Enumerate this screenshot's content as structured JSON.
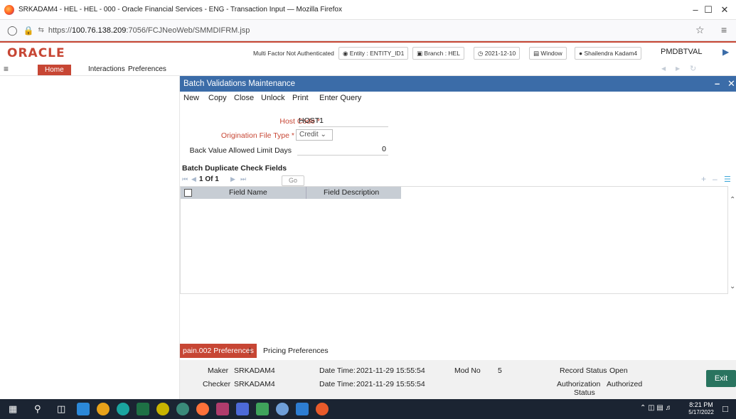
{
  "browser": {
    "window_title": "SRKADAM4 - HEL - HEL - 000 - Oracle Financial Services - ENG - Transaction Input — Mozilla Firefox",
    "url_prefix": "https://",
    "url_host": "100.76.138.209",
    "url_rest": ":7056/FCJNeoWeb/SMMDIFRM.jsp"
  },
  "header": {
    "logo": "ORACLE",
    "mfa": "Multi Factor Not Authenticated",
    "entity": "Entity : ENTITY_ID1",
    "branch": "Branch : HEL",
    "date": "2021-12-10",
    "window": "Window",
    "user": "Shailendra Kadam4",
    "function_id": "PMDBTVAL"
  },
  "menu": {
    "home": "Home",
    "interactions": "Interactions",
    "preferences": "Preferences"
  },
  "form": {
    "title": "Batch Validations Maintenance",
    "toolbar": {
      "new": "New",
      "copy": "Copy",
      "close": "Close",
      "unlock": "Unlock",
      "print": "Print",
      "enter_query": "Enter Query"
    },
    "host_code_label": "Host Code",
    "host_code_value": "HOST1",
    "orig_type_label": "Origination File Type",
    "orig_type_value": "Credit",
    "back_value_label": "Back Value Allowed Limit Days",
    "back_value_value": "0",
    "section_title": "Batch Duplicate Check Fields",
    "pager": "1 Of 1",
    "go": "Go",
    "columns": [
      "Field Name",
      "Field Description"
    ]
  },
  "tabs": {
    "active": "pain.002 Preferences",
    "separator": "|",
    "other": "Pricing Preferences"
  },
  "footer": {
    "maker_label": "Maker",
    "maker": "SRKADAM4",
    "checker_label": "Checker",
    "checker": "SRKADAM4",
    "datetime_label": "Date Time:",
    "maker_datetime": "2021-11-29 15:55:54",
    "checker_datetime": "2021-11-29 15:55:54",
    "modno_label": "Mod No",
    "modno": "5",
    "record_status_label": "Record Status",
    "record_status": "Open",
    "auth_label_1": "Authorization",
    "auth_label_2": "Status",
    "auth_status": "Authorized",
    "exit": "Exit"
  },
  "taskbar": {
    "time": "8:21 PM",
    "date": "5/17/2022"
  },
  "colors": {
    "oracle_red": "#c74634",
    "window_title_blue": "#3b6ca8",
    "exit_green": "#29745f"
  }
}
